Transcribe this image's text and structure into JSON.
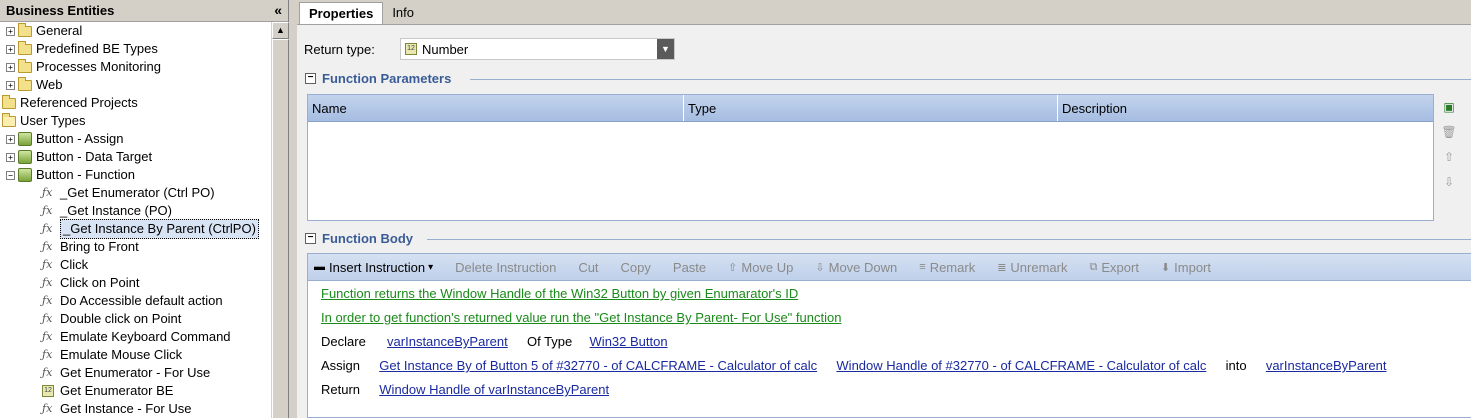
{
  "left_panel": {
    "title": "Business Entities",
    "collapse_glyph": "«",
    "tree": [
      {
        "label": "General",
        "indent": 0,
        "icon": "folder-icon",
        "expander": "+"
      },
      {
        "label": "Predefined BE Types",
        "indent": 0,
        "icon": "folder-icon",
        "expander": "+"
      },
      {
        "label": "Processes Monitoring",
        "indent": 0,
        "icon": "folder-icon",
        "expander": "+"
      },
      {
        "label": "Web",
        "indent": 0,
        "icon": "folder-icon",
        "expander": "+"
      },
      {
        "label": "Referenced Projects",
        "indent": -1,
        "icon": "folder-icon",
        "expander": ""
      },
      {
        "label": "User Types",
        "indent": -1,
        "icon": "folder-open-icon",
        "expander": ""
      },
      {
        "label": "Button - Assign",
        "indent": 0,
        "icon": "business-type-icon",
        "expander": "+"
      },
      {
        "label": "Button - Data Target",
        "indent": 0,
        "icon": "business-type-icon",
        "expander": "+"
      },
      {
        "label": "Button - Function",
        "indent": 0,
        "icon": "business-type-icon",
        "expander": "−"
      },
      {
        "label": "_Get Enumerator (Ctrl PO)",
        "indent": 1,
        "icon": "function-icon",
        "expander": ""
      },
      {
        "label": "_Get Instance (PO)",
        "indent": 1,
        "icon": "function-icon",
        "expander": ""
      },
      {
        "label": "_Get Instance By Parent (CtrlPO)",
        "indent": 1,
        "icon": "function-icon",
        "expander": "",
        "selected": true
      },
      {
        "label": "Bring to Front",
        "indent": 1,
        "icon": "function-icon",
        "expander": ""
      },
      {
        "label": "Click",
        "indent": 1,
        "icon": "function-icon",
        "expander": ""
      },
      {
        "label": "Click on Point",
        "indent": 1,
        "icon": "function-icon",
        "expander": ""
      },
      {
        "label": "Do Accessible default action",
        "indent": 1,
        "icon": "function-icon",
        "expander": ""
      },
      {
        "label": "Double click on Point",
        "indent": 1,
        "icon": "function-icon",
        "expander": ""
      },
      {
        "label": "Emulate Keyboard Command",
        "indent": 1,
        "icon": "function-icon",
        "expander": ""
      },
      {
        "label": "Emulate Mouse Click",
        "indent": 1,
        "icon": "function-icon",
        "expander": ""
      },
      {
        "label": "Get Enumerator - For Use",
        "indent": 1,
        "icon": "function-icon",
        "expander": ""
      },
      {
        "label": "Get Enumerator BE",
        "indent": 1,
        "icon": "number-type-icon",
        "expander": ""
      },
      {
        "label": "Get Instance - For Use",
        "indent": 1,
        "icon": "function-icon",
        "expander": ""
      }
    ]
  },
  "tabs": [
    {
      "label": "Properties",
      "active": true
    },
    {
      "label": "Info",
      "active": false
    }
  ],
  "properties": {
    "return_type_label": "Return type:",
    "return_type_value": "Number",
    "params_section": "Function Parameters",
    "params_columns": [
      "Name",
      "Type",
      "Description"
    ],
    "body_section": "Function Body"
  },
  "toolbar": [
    {
      "label": "Insert Instruction",
      "icon": "insert-icon",
      "enabled": true,
      "dropdown": "▾"
    },
    {
      "label": "Delete Instruction",
      "icon": "",
      "enabled": false
    },
    {
      "label": "Cut",
      "icon": "",
      "enabled": false
    },
    {
      "label": "Copy",
      "icon": "",
      "enabled": false
    },
    {
      "label": "Paste",
      "icon": "",
      "enabled": false
    },
    {
      "label": "Move Up",
      "icon": "move-up-icon",
      "enabled": false
    },
    {
      "label": "Move Down",
      "icon": "move-down-icon",
      "enabled": false
    },
    {
      "label": "Remark",
      "icon": "remark-icon",
      "enabled": false
    },
    {
      "label": "Unremark",
      "icon": "unremark-icon",
      "enabled": false
    },
    {
      "label": "Export",
      "icon": "export-icon",
      "enabled": false
    },
    {
      "label": "Import",
      "icon": "import-icon",
      "enabled": false
    }
  ],
  "code": {
    "comment1": "Function returns the Window Handle of the Win32 Button by given Enumarator's ID",
    "comment2": "In order to get function's returned value run the \"Get Instance By Parent- For Use\" function",
    "declare_kw": "Declare",
    "declare_var": "varInstanceByParent",
    "oftype_kw": "Of Type",
    "declare_type": "Win32 Button",
    "assign_kw": "Assign",
    "assign_src": "Get Instance By of Button 5 of #32770 -  of CALCFRAME - Calculator of calc",
    "assign_arg": "Window Handle of #32770 -  of CALCFRAME - Calculator of calc",
    "into_kw": "into",
    "assign_target": "varInstanceByParent",
    "return_kw": "Return",
    "return_val": "Window Handle of varInstanceByParent"
  },
  "colors": {
    "section_title": "#3a5c96",
    "comment": "#1a8a1a",
    "link": "#1a2aa0"
  }
}
